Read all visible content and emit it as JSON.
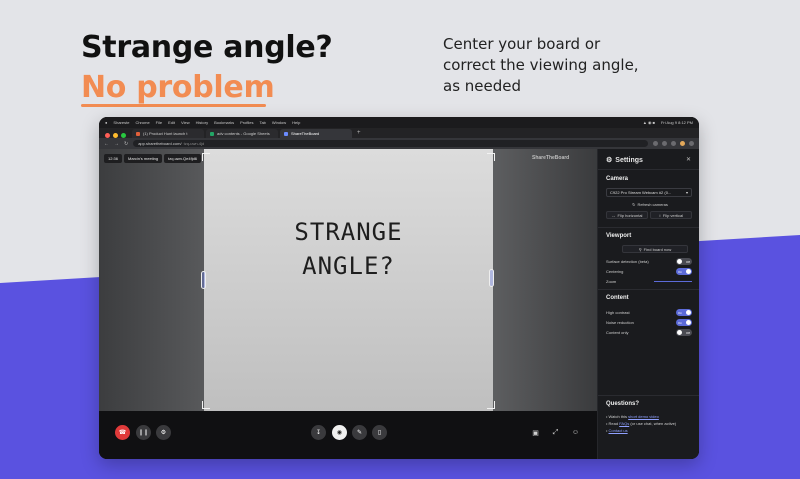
{
  "marketing": {
    "headline_line1": "Strange angle?",
    "headline_line2": "No problem",
    "subcopy": "Center your board or correct the viewing angle, as needed",
    "accent_color": "#f28c52",
    "band_color": "#5a52e0"
  },
  "os_menubar": {
    "app": "Shareste",
    "items": [
      "Chrome",
      "File",
      "Edit",
      "View",
      "History",
      "Bookmarks",
      "Profiles",
      "Tab",
      "Window",
      "Help"
    ],
    "clock": "Fri Aug 9  8:12 PM"
  },
  "browser": {
    "tabs": [
      {
        "label": "(1) Product Hunt launch t"
      },
      {
        "label": "adv contents - Google Sheets"
      },
      {
        "label": "ShareTheBoard"
      }
    ],
    "new_tab": "+",
    "url": "app.sharetheboard.com/",
    "url_rest": "tzq-uwn-4jd"
  },
  "stage": {
    "chips": [
      "12:36",
      "Marcin's meeting",
      "tzq.uwn.Qe4fjd6"
    ],
    "brand": "ShareTheBoard",
    "board_text_line1": "STRANGE",
    "board_text_line2": "ANGLE?"
  },
  "toolbar": {
    "hangup_icon": "phone-hangup-icon",
    "pause_icon": "pause-icon",
    "settings_icon": "gear-icon",
    "download_icon": "download-icon",
    "camera_icon": "camera-icon",
    "pen_icon": "pen-icon",
    "eraser_icon": "eraser-icon",
    "gallery_icon": "gallery-icon",
    "fit_icon": "fit-screen-icon",
    "people_icon": "people-icon"
  },
  "settings": {
    "title": "Settings",
    "camera": {
      "heading": "Camera",
      "selected_camera": "C922 Pro Stream Webcam #2 (0...",
      "refresh": "Refresh cameras",
      "flip_h": "Flip horizontal",
      "flip_v": "Flip vertical"
    },
    "viewport": {
      "heading": "Viewport",
      "find_board": "Find board now",
      "surface_detection": {
        "label": "Surface detection (beta)",
        "state": "Off"
      },
      "centering": {
        "label": "Centering",
        "state": "On"
      },
      "zoom": {
        "label": "Zoom"
      }
    },
    "content": {
      "heading": "Content",
      "high_contrast": {
        "label": "High contrast",
        "state": "On"
      },
      "noise_reduction": {
        "label": "Noise reduction",
        "state": "On"
      },
      "content_only": {
        "label": "Content only",
        "state": "Off"
      }
    },
    "questions": {
      "heading": "Questions?",
      "item1_prefix": "Watch this",
      "item1_link": "short demo video",
      "item2_prefix": "Read",
      "item2_link": "FAQs",
      "item2_suffix": "(or use chat, when active)",
      "item3_link": "Contact us"
    }
  }
}
